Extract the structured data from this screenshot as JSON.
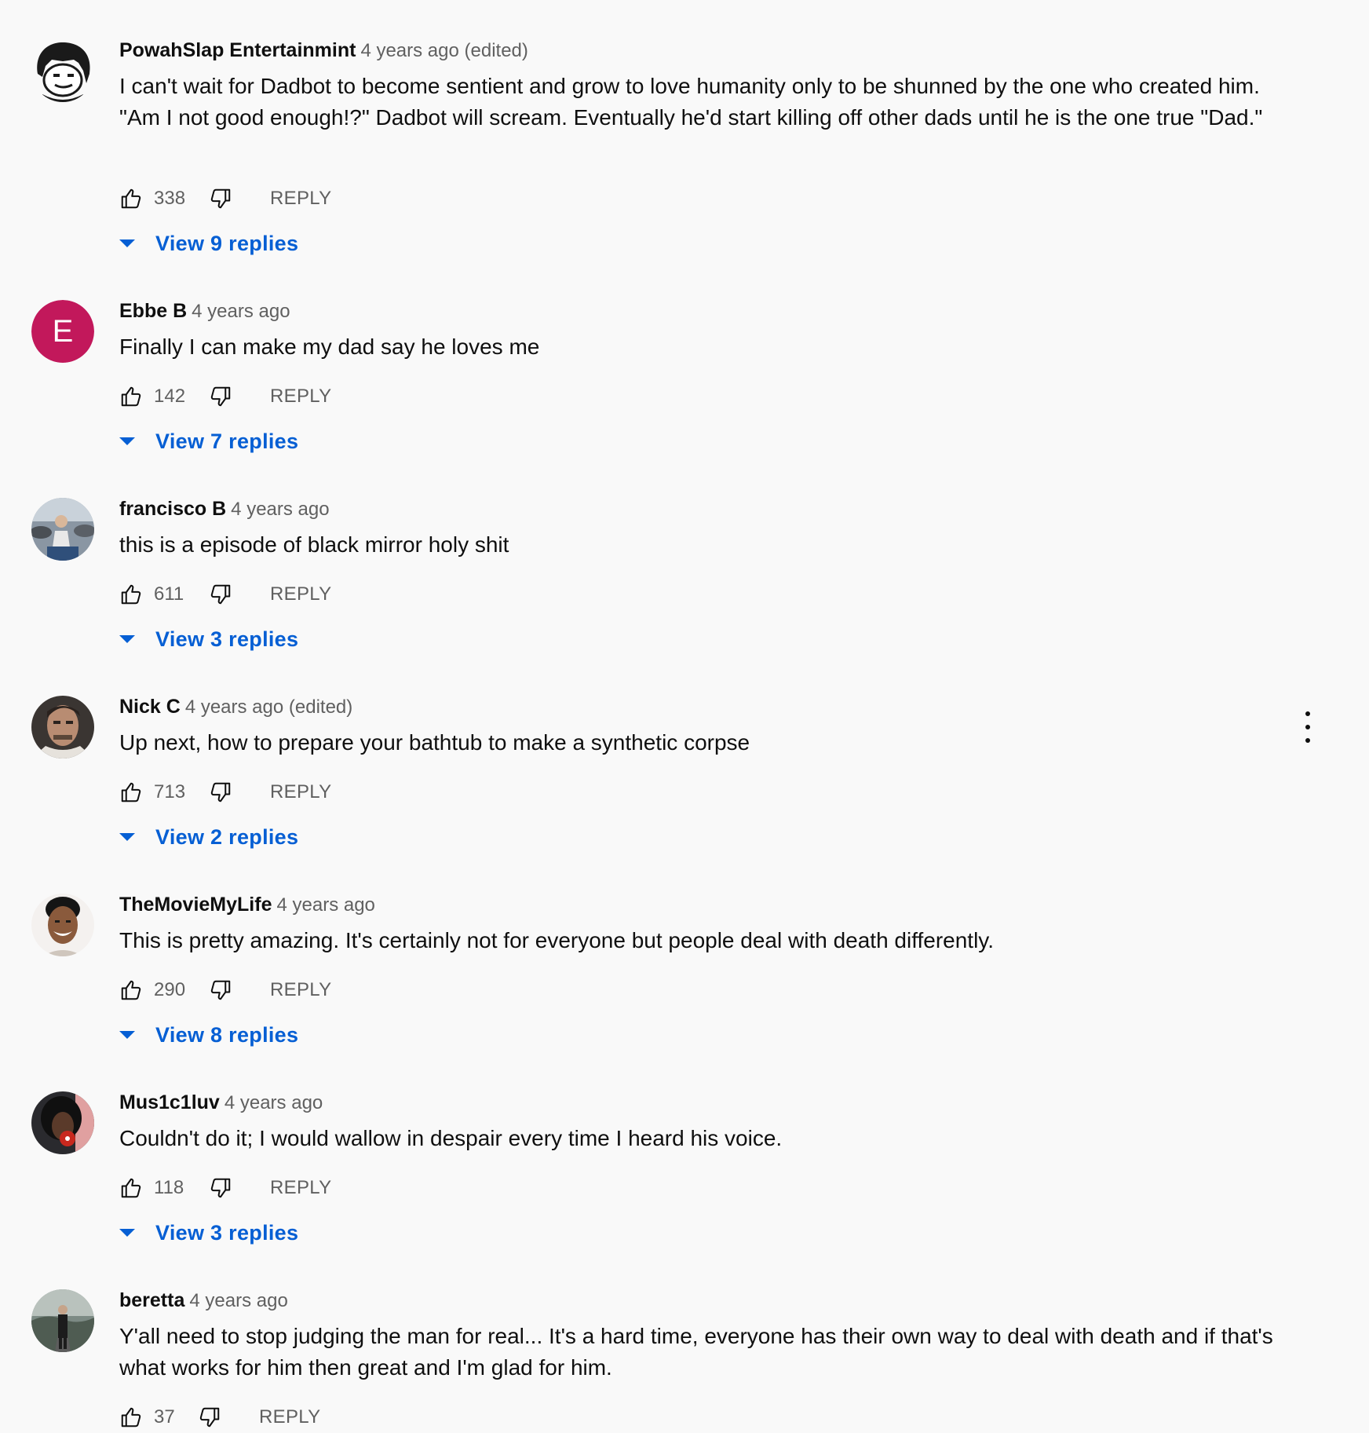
{
  "comments": [
    {
      "author": "PowahSlap Entertainmint",
      "time": "4 years ago (edited)",
      "text": "I can't wait for Dadbot to become sentient and grow to love humanity only to be shunned by the one who created him. \"Am I not good enough!?\" Dadbot will scream. Eventually he'd start killing off other dads until he is the one true \"Dad.\"",
      "likes": "338",
      "reply_label": "REPLY",
      "view_replies": "View 9 replies",
      "avatar_icon": "cartoon-face-avatar"
    },
    {
      "author": "Ebbe B",
      "time": "4 years ago",
      "text": "Finally I can make my dad say he loves me",
      "likes": "142",
      "reply_label": "REPLY",
      "view_replies": "View 7 replies",
      "avatar_letter": "E",
      "avatar_color": "#c2185b"
    },
    {
      "author": "francisco B",
      "time": "4 years ago",
      "text": "this is a episode of black mirror holy shit",
      "likes": "611",
      "reply_label": "REPLY",
      "view_replies": "View 3 replies",
      "avatar_icon": "photo-avatar"
    },
    {
      "author": "Nick C",
      "time": "4 years ago (edited)",
      "text": "Up next, how to prepare your bathtub to make a synthetic corpse",
      "likes": "713",
      "reply_label": "REPLY",
      "view_replies": "View 2 replies",
      "avatar_icon": "photo-avatar",
      "more_icon": "vertical-ellipsis-icon"
    },
    {
      "author": "TheMovieMyLife",
      "time": "4 years ago",
      "text": "This is pretty amazing. It's certainly not for everyone but people deal with death differently.",
      "likes": "290",
      "reply_label": "REPLY",
      "view_replies": "View 8 replies",
      "avatar_icon": "photo-avatar"
    },
    {
      "author": "Mus1c1luv",
      "time": "4 years ago",
      "text": "Couldn't do it; I would wallow in despair every time I heard his voice.",
      "likes": "118",
      "reply_label": "REPLY",
      "view_replies": "View 3 replies",
      "avatar_icon": "photo-avatar"
    },
    {
      "author": "beretta",
      "time": "4 years ago",
      "text": "Y'all need to stop judging the man for real... It's a hard time, everyone has their own way to deal with death and if that's what works for him then great and I'm glad for him.",
      "likes": "37",
      "reply_label": "REPLY",
      "avatar_icon": "photo-avatar"
    }
  ],
  "colors": {
    "link_blue": "#065fd4",
    "secondary_text": "#606060",
    "background": "#f9f9f9"
  },
  "icons": {
    "like": "thumbs-up-icon",
    "dislike": "thumbs-down-icon",
    "expand": "caret-down-icon"
  }
}
